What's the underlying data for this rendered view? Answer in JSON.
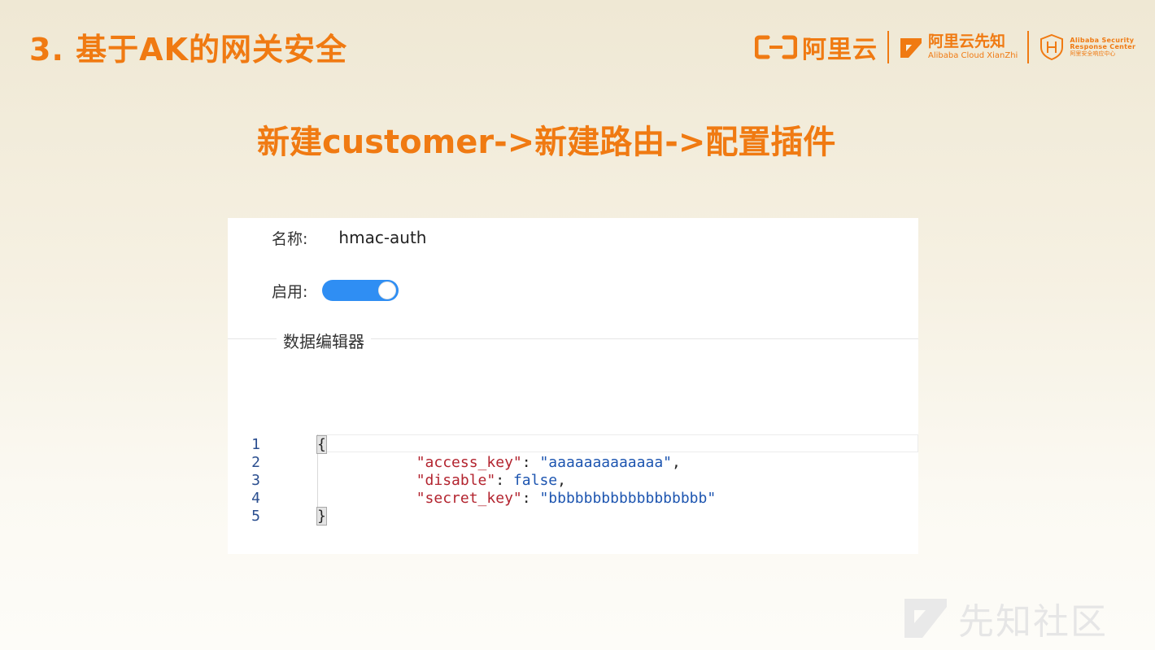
{
  "slide": {
    "title": "3. 基于AK的网关安全",
    "subtitle": "新建customer->新建路由->配置插件"
  },
  "logos": {
    "aliyun": "阿里云",
    "xianzhi_cn": "阿里云先知",
    "xianzhi_en": "Alibaba Cloud XianZhi",
    "asrc_line1": "Alibaba Security",
    "asrc_line2": "Response Center",
    "asrc_line3": "阿里安全响应中心"
  },
  "form": {
    "name_label": "名称:",
    "name_value": "hmac-auth",
    "enable_label": "启用:",
    "enabled": true,
    "editor_title": "数据编辑器"
  },
  "editor": {
    "line_numbers": [
      "1",
      "2",
      "3",
      "4",
      "5"
    ],
    "open_brace": "{",
    "close_brace": "}",
    "lines": [
      {
        "key": "\"access_key\"",
        "sep": ": ",
        "value": "\"aaaaaaaaaaaaa\"",
        "tail": ","
      },
      {
        "key": "\"disable\"",
        "sep": ": ",
        "value": "false",
        "tail": ","
      },
      {
        "key": "\"secret_key\"",
        "sep": ": ",
        "value": "\"bbbbbbbbbbbbbbbbbb\"",
        "tail": ""
      }
    ]
  },
  "watermark": {
    "text": "先知社区"
  },
  "colors": {
    "accent": "#f07a12",
    "toggle_on": "#2f8ef3",
    "json_key": "#b3242f",
    "json_value": "#1d55b0"
  }
}
